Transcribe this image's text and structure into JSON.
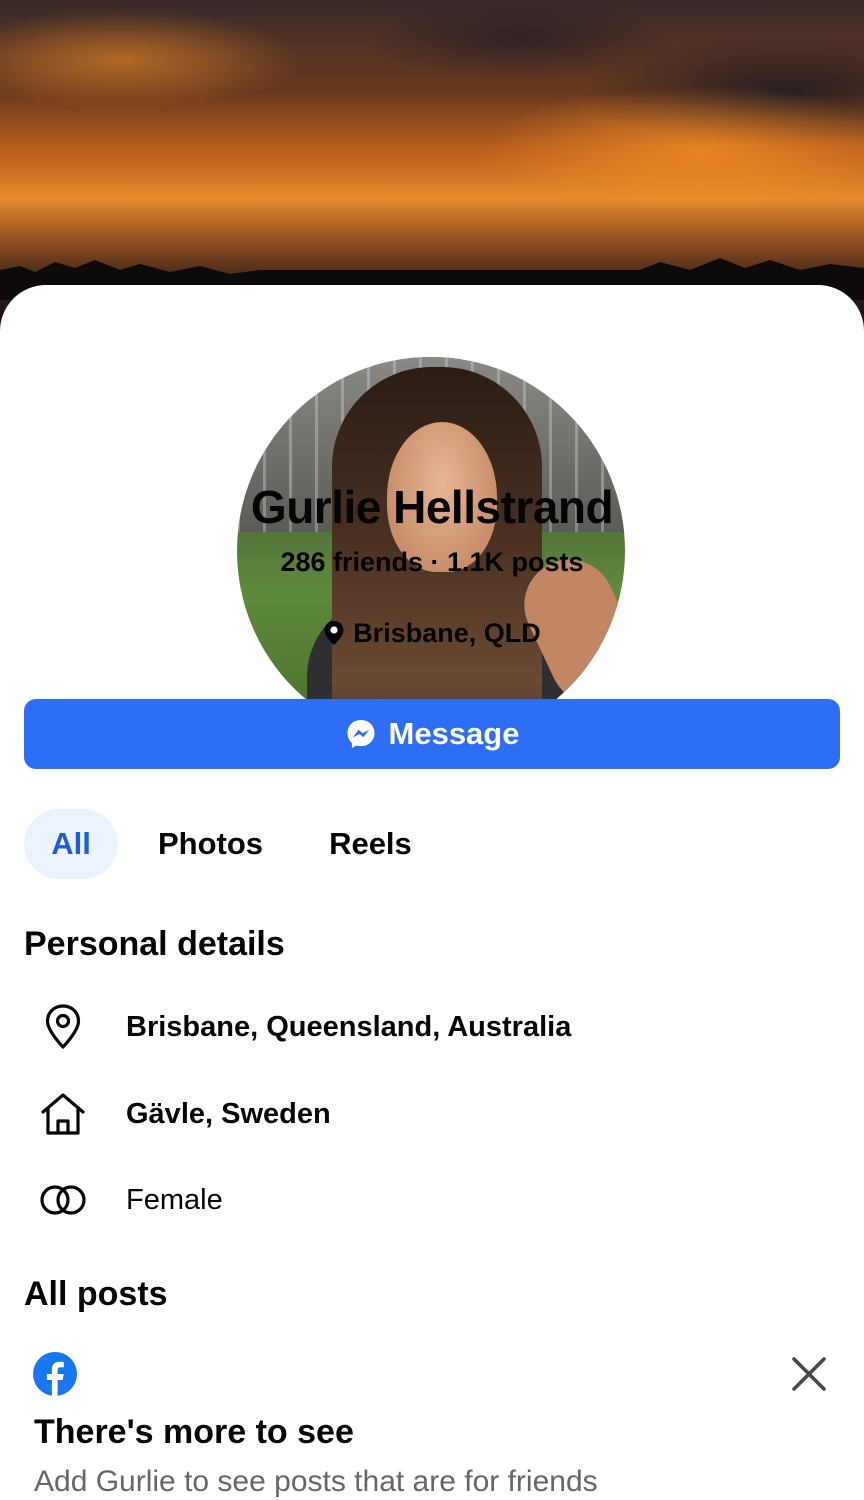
{
  "profile": {
    "name": "Gurlie Hellstrand",
    "stats": "286 friends · 1.1K posts",
    "location": "Brisbane, QLD",
    "message_label": "Message"
  },
  "tabs": [
    {
      "label": "All",
      "active": true
    },
    {
      "label": "Photos",
      "active": false
    },
    {
      "label": "Reels",
      "active": false
    }
  ],
  "personal_details": {
    "title": "Personal details",
    "items": [
      {
        "icon": "location-pin-icon",
        "text": "Brisbane, Queensland, Australia"
      },
      {
        "icon": "home-icon",
        "text": "Gävle, Sweden"
      },
      {
        "icon": "gender-icon",
        "text": "Female"
      }
    ]
  },
  "all_posts": {
    "title": "All posts",
    "prompt_title": "There's more to see",
    "prompt_subtitle": "Add Gurlie to see posts that are for friends"
  },
  "colors": {
    "accent": "#2d6ef6",
    "active_tab_bg": "#ebf3fe",
    "active_tab_text": "#1f5fd6",
    "secondary_text": "#65676b",
    "facebook_blue": "#1877f2"
  }
}
